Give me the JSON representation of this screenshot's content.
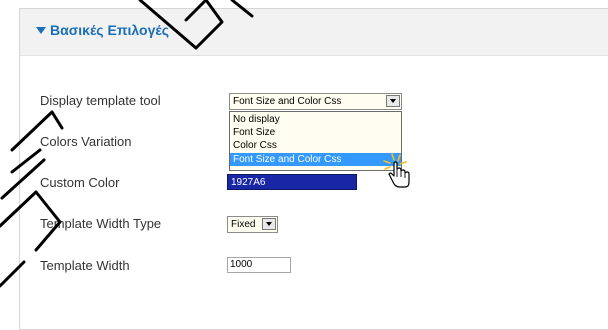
{
  "section": {
    "title": "Βασικές Επιλογές",
    "arrow_icon": "triangle-down-icon"
  },
  "fields": {
    "display_template_tool": {
      "label": "Display template tool",
      "selected": "Font Size and Color Css",
      "options": [
        "No display",
        "Font Size",
        "Color Css",
        "Font Size and Color Css"
      ]
    },
    "colors_variation": {
      "label": "Colors Variation"
    },
    "custom_color": {
      "label": "Custom Color",
      "value": "1927A6",
      "color": "#1927A6"
    },
    "template_width_type": {
      "label": "Template Width Type",
      "selected": "Fixed"
    },
    "template_width": {
      "label": "Template Width",
      "value": "1000"
    }
  },
  "colors": {
    "accent": "#1B6FB6",
    "selection": "#3399FF",
    "watermark": "#000000"
  },
  "cursor_icon": "hand-pointer-icon",
  "watermark_icon": "diagonal-lettering-watermark"
}
